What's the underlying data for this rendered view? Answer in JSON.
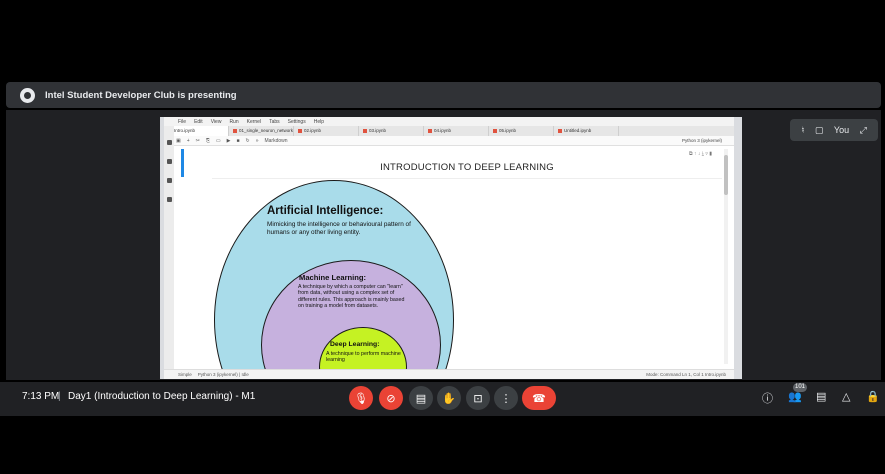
{
  "presenting": {
    "text": "Intel Student Developer Club is presenting"
  },
  "self_tile": {
    "label": "You"
  },
  "notebook": {
    "menu": [
      "File",
      "Edit",
      "View",
      "Run",
      "Kernel",
      "Tabs",
      "Settings",
      "Help"
    ],
    "tabs": [
      "Intro.ipynb",
      "01_single_neuron_network.ipynb",
      "02.ipynb",
      "03.ipynb",
      "04.ipynb",
      "05.ipynb",
      "Untitled.ipynb"
    ],
    "toolbar_cell_type": "Markdown",
    "kernel": "Python 3 (ipykernel)",
    "heading": "INTRODUCTION TO DEEP LEARNING",
    "status_left": "Simple",
    "status_kernel": "Python 3 (ipykernel) | Idle",
    "status_right": "Mode: Command   Ln 1, Col 1   Intro.ipynb"
  },
  "diagram": {
    "ai_title": "Artificial Intelligence:",
    "ai_desc": "Mimicking the intelligence or behavioural pattern of humans or any other living entity.",
    "ml_title": "Machine Learning:",
    "ml_desc": "A technique by which a computer can \"learn\" from data, without using a complex set of different rules. This approach is mainly based on training a model from datasets.",
    "dl_title": "Deep Learning:",
    "dl_desc": "A technique to perform machine learning",
    "colors": {
      "ai": "#a9dcea",
      "ml": "#c6b1de",
      "dl": "#c5f223"
    }
  },
  "bottom": {
    "time": "7:13 PM",
    "separator": "|",
    "meeting_title": "Day1 (Introduction to Deep Learning) - M1",
    "participant_count": "101"
  },
  "icons": {
    "mic_off": "mic-off-icon",
    "cam_off": "camera-off-icon",
    "captions": "captions-icon",
    "raise_hand": "raise-hand-icon",
    "present": "present-icon",
    "more": "more-options-icon",
    "end_call": "end-call-icon",
    "info": "info-icon",
    "people": "people-icon",
    "chat": "chat-icon",
    "activities": "activities-icon",
    "host": "host-controls-icon"
  }
}
